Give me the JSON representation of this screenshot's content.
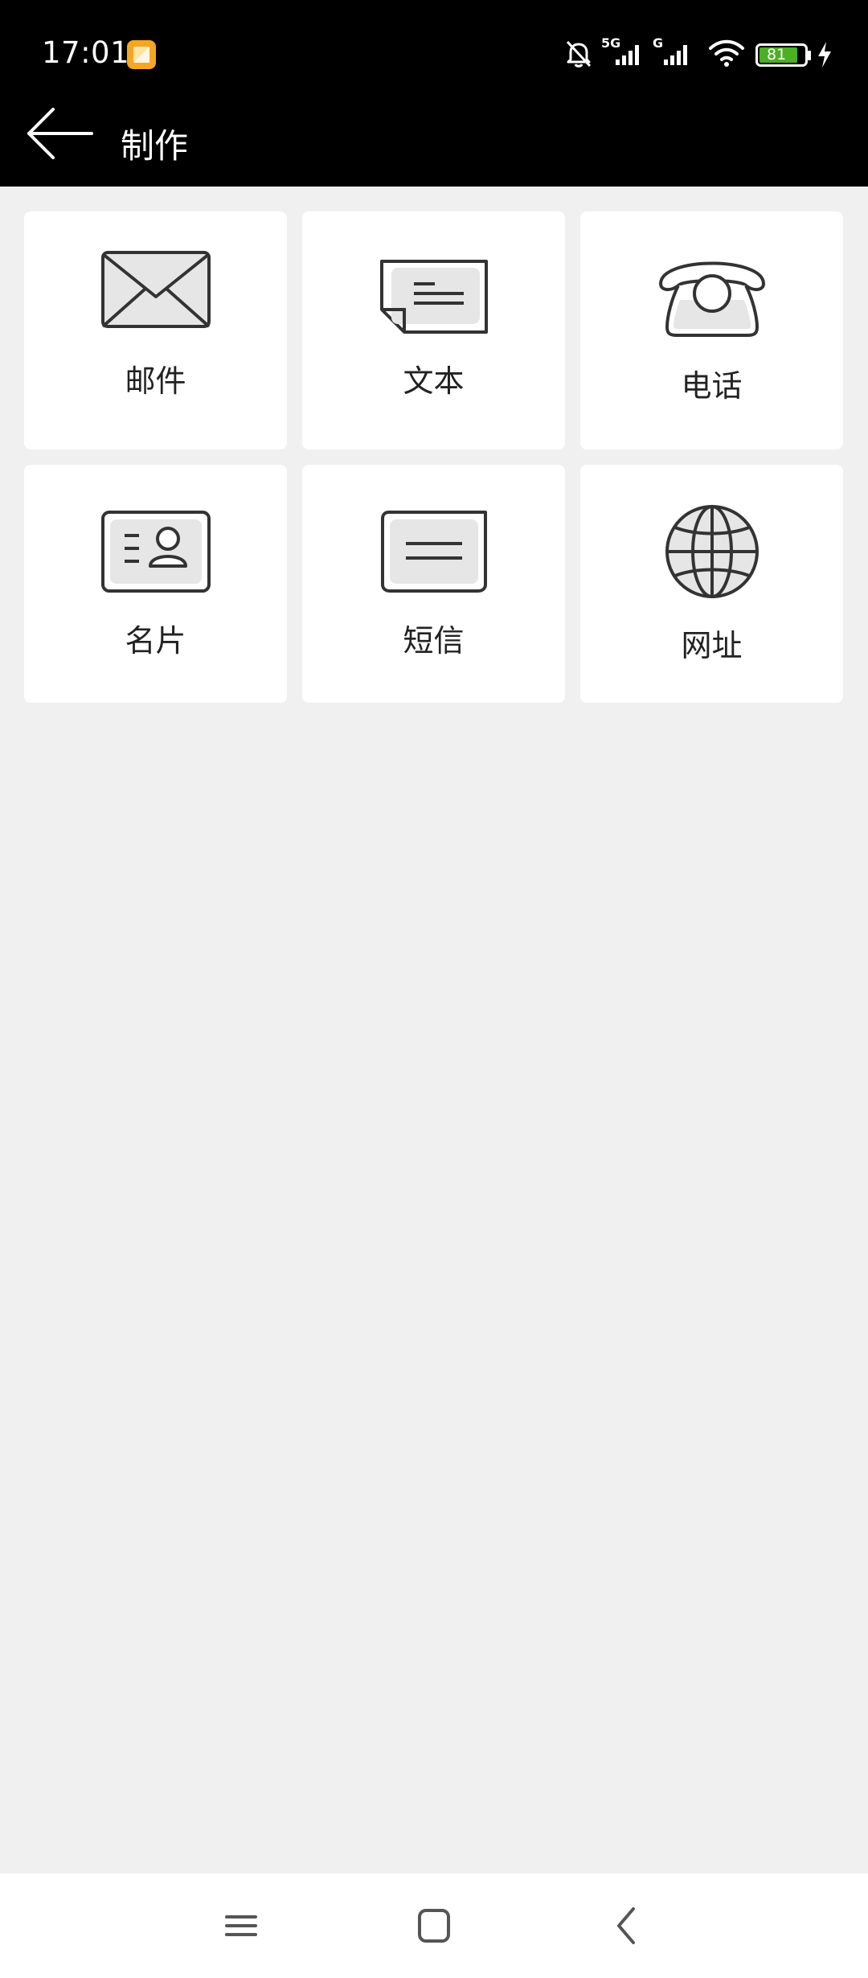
{
  "status_bar": {
    "time": "17:01",
    "network_5g": "5G",
    "network_g": "G",
    "battery": "81",
    "icons": [
      "app-notification-icon",
      "mute-bell-icon",
      "signal-5g-icon",
      "signal-g-icon",
      "wifi-icon",
      "battery-icon",
      "charging-icon"
    ]
  },
  "header": {
    "title": "制作",
    "back_icon": "back-arrow-icon"
  },
  "grid": {
    "items": [
      {
        "label": "邮件",
        "icon": "mail-envelope-icon"
      },
      {
        "label": "文本",
        "icon": "text-note-icon"
      },
      {
        "label": "电话",
        "icon": "telephone-icon"
      },
      {
        "label": "名片",
        "icon": "business-card-icon"
      },
      {
        "label": "短信",
        "icon": "sms-message-icon"
      },
      {
        "label": "网址",
        "icon": "globe-url-icon"
      }
    ]
  },
  "nav_bar": {
    "icons": [
      "menu-icon",
      "home-square-icon",
      "back-chevron-icon"
    ]
  },
  "colors": {
    "status_bar_bg": "#000000",
    "header_bg": "#000000",
    "page_bg": "#f0f0f0",
    "card_bg": "#ffffff",
    "icon_fill": "#e6e6e6",
    "icon_stroke": "#333333",
    "battery_green": "#4caf24"
  }
}
